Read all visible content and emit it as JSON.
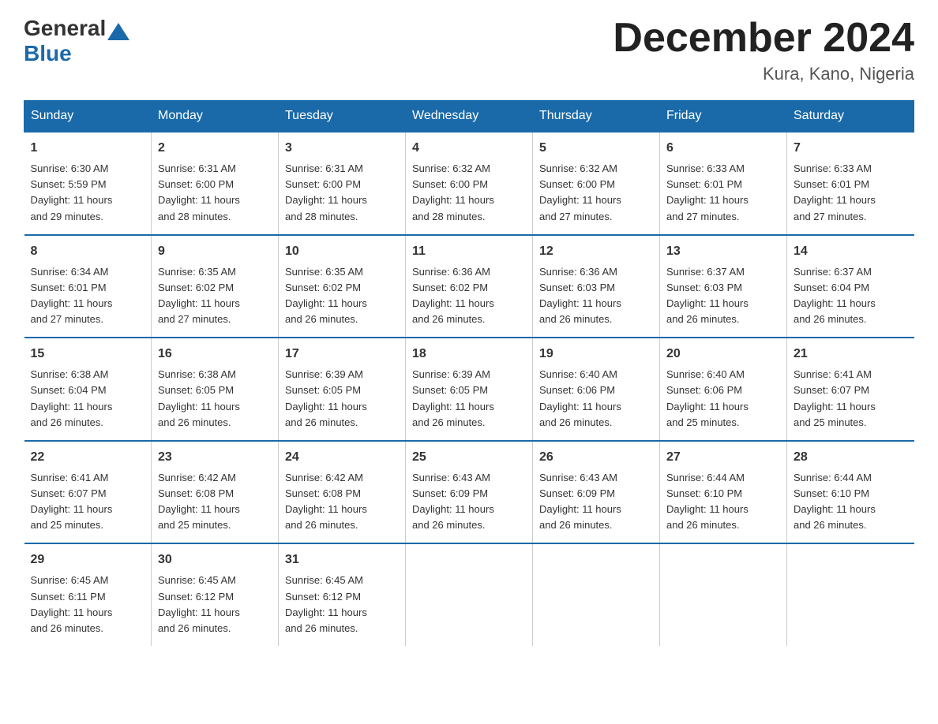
{
  "header": {
    "logo_general": "General",
    "logo_blue": "Blue",
    "month_title": "December 2024",
    "location": "Kura, Kano, Nigeria"
  },
  "days_of_week": [
    "Sunday",
    "Monday",
    "Tuesday",
    "Wednesday",
    "Thursday",
    "Friday",
    "Saturday"
  ],
  "weeks": [
    [
      {
        "day": "1",
        "sunrise": "6:30 AM",
        "sunset": "5:59 PM",
        "daylight": "11 hours and 29 minutes."
      },
      {
        "day": "2",
        "sunrise": "6:31 AM",
        "sunset": "6:00 PM",
        "daylight": "11 hours and 28 minutes."
      },
      {
        "day": "3",
        "sunrise": "6:31 AM",
        "sunset": "6:00 PM",
        "daylight": "11 hours and 28 minutes."
      },
      {
        "day": "4",
        "sunrise": "6:32 AM",
        "sunset": "6:00 PM",
        "daylight": "11 hours and 28 minutes."
      },
      {
        "day": "5",
        "sunrise": "6:32 AM",
        "sunset": "6:00 PM",
        "daylight": "11 hours and 27 minutes."
      },
      {
        "day": "6",
        "sunrise": "6:33 AM",
        "sunset": "6:01 PM",
        "daylight": "11 hours and 27 minutes."
      },
      {
        "day": "7",
        "sunrise": "6:33 AM",
        "sunset": "6:01 PM",
        "daylight": "11 hours and 27 minutes."
      }
    ],
    [
      {
        "day": "8",
        "sunrise": "6:34 AM",
        "sunset": "6:01 PM",
        "daylight": "11 hours and 27 minutes."
      },
      {
        "day": "9",
        "sunrise": "6:35 AM",
        "sunset": "6:02 PM",
        "daylight": "11 hours and 27 minutes."
      },
      {
        "day": "10",
        "sunrise": "6:35 AM",
        "sunset": "6:02 PM",
        "daylight": "11 hours and 26 minutes."
      },
      {
        "day": "11",
        "sunrise": "6:36 AM",
        "sunset": "6:02 PM",
        "daylight": "11 hours and 26 minutes."
      },
      {
        "day": "12",
        "sunrise": "6:36 AM",
        "sunset": "6:03 PM",
        "daylight": "11 hours and 26 minutes."
      },
      {
        "day": "13",
        "sunrise": "6:37 AM",
        "sunset": "6:03 PM",
        "daylight": "11 hours and 26 minutes."
      },
      {
        "day": "14",
        "sunrise": "6:37 AM",
        "sunset": "6:04 PM",
        "daylight": "11 hours and 26 minutes."
      }
    ],
    [
      {
        "day": "15",
        "sunrise": "6:38 AM",
        "sunset": "6:04 PM",
        "daylight": "11 hours and 26 minutes."
      },
      {
        "day": "16",
        "sunrise": "6:38 AM",
        "sunset": "6:05 PM",
        "daylight": "11 hours and 26 minutes."
      },
      {
        "day": "17",
        "sunrise": "6:39 AM",
        "sunset": "6:05 PM",
        "daylight": "11 hours and 26 minutes."
      },
      {
        "day": "18",
        "sunrise": "6:39 AM",
        "sunset": "6:05 PM",
        "daylight": "11 hours and 26 minutes."
      },
      {
        "day": "19",
        "sunrise": "6:40 AM",
        "sunset": "6:06 PM",
        "daylight": "11 hours and 26 minutes."
      },
      {
        "day": "20",
        "sunrise": "6:40 AM",
        "sunset": "6:06 PM",
        "daylight": "11 hours and 25 minutes."
      },
      {
        "day": "21",
        "sunrise": "6:41 AM",
        "sunset": "6:07 PM",
        "daylight": "11 hours and 25 minutes."
      }
    ],
    [
      {
        "day": "22",
        "sunrise": "6:41 AM",
        "sunset": "6:07 PM",
        "daylight": "11 hours and 25 minutes."
      },
      {
        "day": "23",
        "sunrise": "6:42 AM",
        "sunset": "6:08 PM",
        "daylight": "11 hours and 25 minutes."
      },
      {
        "day": "24",
        "sunrise": "6:42 AM",
        "sunset": "6:08 PM",
        "daylight": "11 hours and 26 minutes."
      },
      {
        "day": "25",
        "sunrise": "6:43 AM",
        "sunset": "6:09 PM",
        "daylight": "11 hours and 26 minutes."
      },
      {
        "day": "26",
        "sunrise": "6:43 AM",
        "sunset": "6:09 PM",
        "daylight": "11 hours and 26 minutes."
      },
      {
        "day": "27",
        "sunrise": "6:44 AM",
        "sunset": "6:10 PM",
        "daylight": "11 hours and 26 minutes."
      },
      {
        "day": "28",
        "sunrise": "6:44 AM",
        "sunset": "6:10 PM",
        "daylight": "11 hours and 26 minutes."
      }
    ],
    [
      {
        "day": "29",
        "sunrise": "6:45 AM",
        "sunset": "6:11 PM",
        "daylight": "11 hours and 26 minutes."
      },
      {
        "day": "30",
        "sunrise": "6:45 AM",
        "sunset": "6:12 PM",
        "daylight": "11 hours and 26 minutes."
      },
      {
        "day": "31",
        "sunrise": "6:45 AM",
        "sunset": "6:12 PM",
        "daylight": "11 hours and 26 minutes."
      },
      {
        "day": "",
        "sunrise": "",
        "sunset": "",
        "daylight": ""
      },
      {
        "day": "",
        "sunrise": "",
        "sunset": "",
        "daylight": ""
      },
      {
        "day": "",
        "sunrise": "",
        "sunset": "",
        "daylight": ""
      },
      {
        "day": "",
        "sunrise": "",
        "sunset": "",
        "daylight": ""
      }
    ]
  ],
  "labels": {
    "sunrise": "Sunrise:",
    "sunset": "Sunset:",
    "daylight": "Daylight:"
  },
  "colors": {
    "header_bg": "#1a6aaa",
    "header_text": "#ffffff",
    "border": "#1a6aaa"
  }
}
